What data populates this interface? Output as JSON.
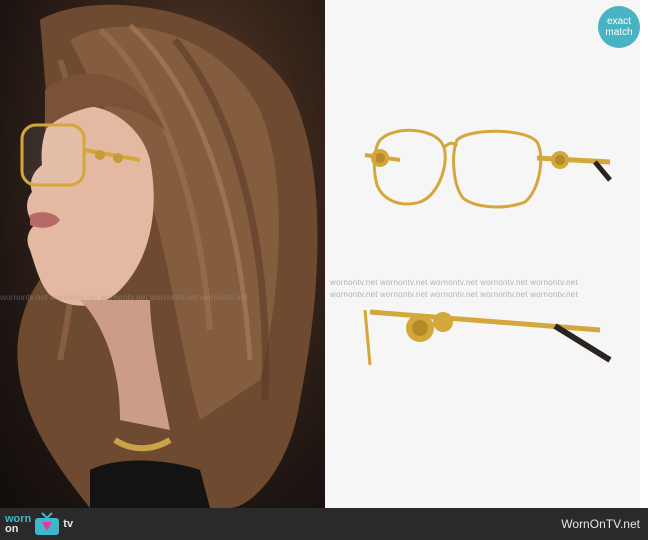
{
  "badge": {
    "line1": "exact",
    "line2": "match"
  },
  "watermark": {
    "text": "wornontv.net  wornontv.net  wornontv.net  wornontv.net  wornontv.net"
  },
  "logo": {
    "worn": "worn",
    "on": "on",
    "tv": "tv"
  },
  "footer": {
    "site": "WornOnTV.net"
  },
  "colors": {
    "badge": "#49b3c3",
    "footer": "#2a2a2a",
    "brand": "#3fb6c9",
    "frame_gold": "#d4a73a"
  }
}
